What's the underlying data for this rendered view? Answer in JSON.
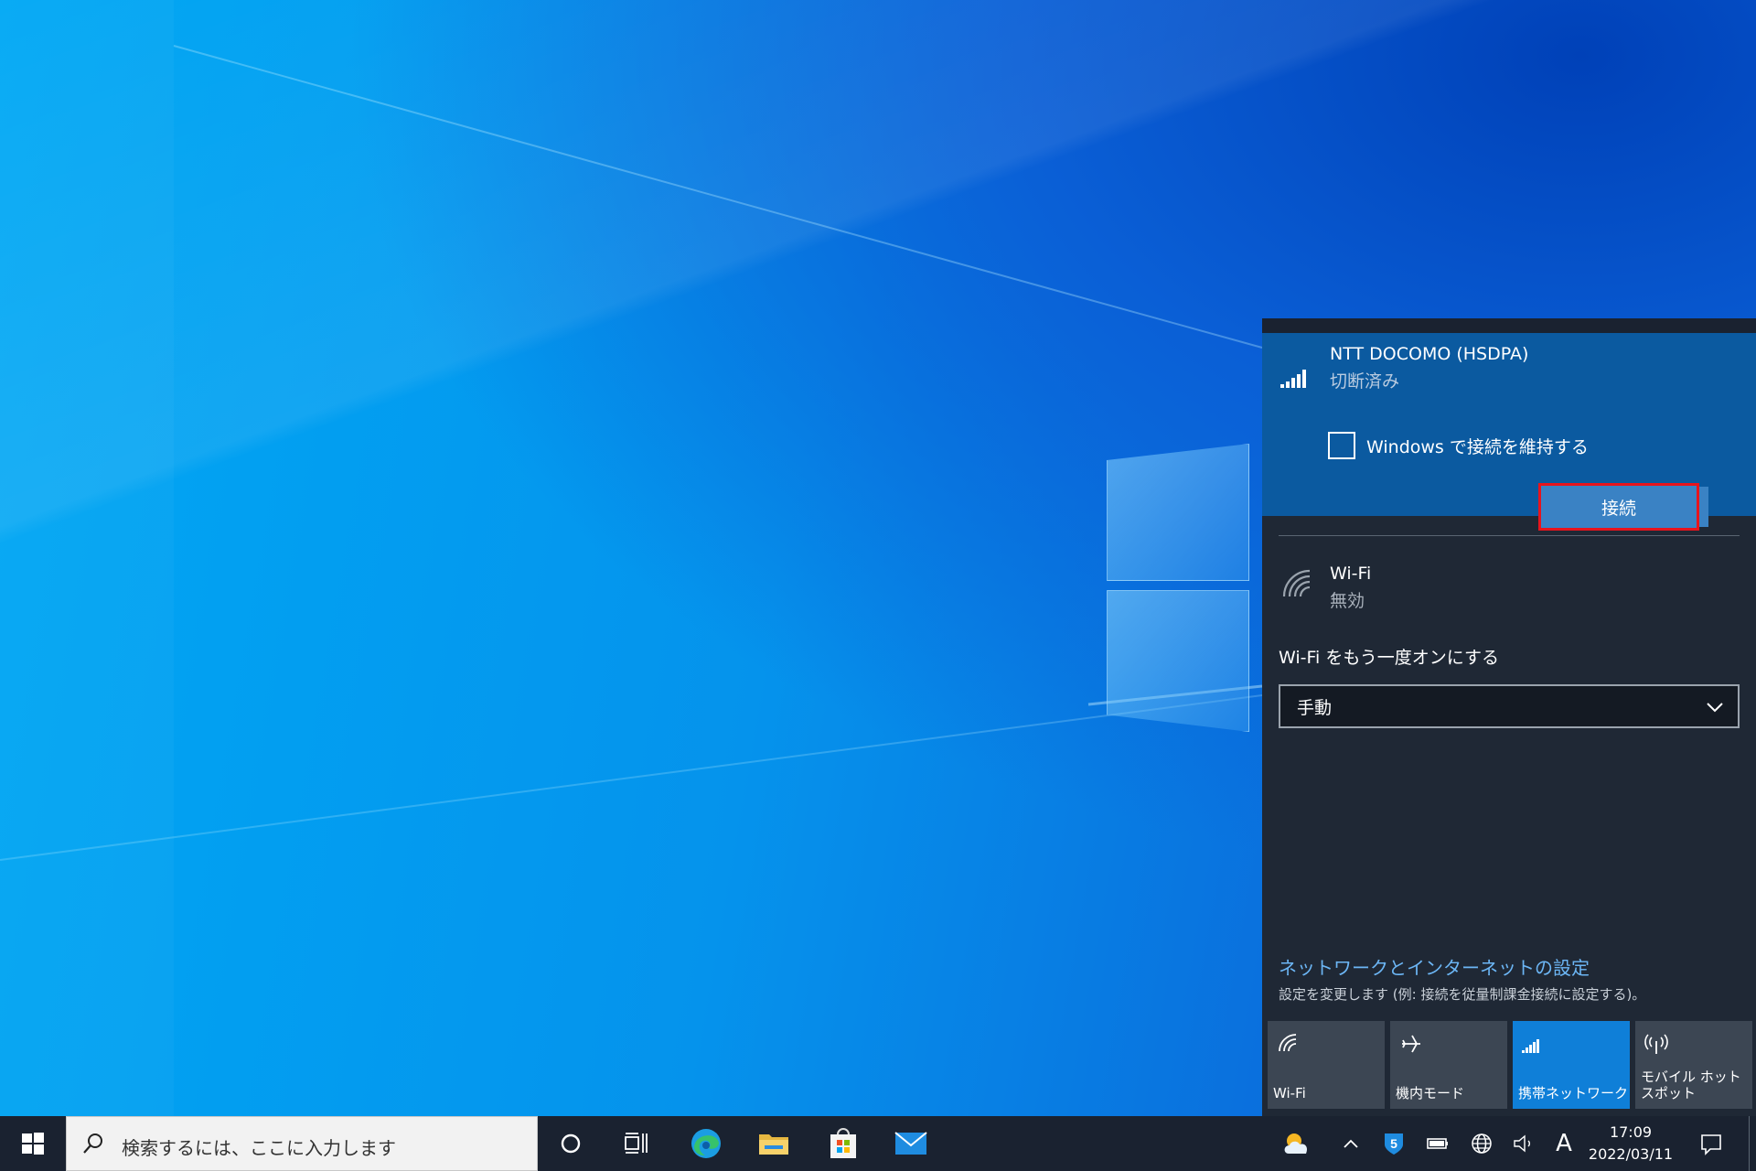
{
  "flyout": {
    "cellular": {
      "name": "NTT DOCOMO (HSDPA)",
      "status": "切断済み",
      "keep_connected_label": "Windows で接続を維持する",
      "keep_connected_checked": false,
      "connect_button": "接続"
    },
    "wifi": {
      "name": "Wi-Fi",
      "status": "無効",
      "turn_on_label": "Wi-Fi をもう一度オンにする",
      "turn_on_value": "手動"
    },
    "settings": {
      "link": "ネットワークとインターネットの設定",
      "description": "設定を変更します (例: 接続を従量制課金接続に設定する)。"
    },
    "tiles": [
      {
        "label": "Wi-Fi",
        "icon": "wifi-icon",
        "active": false
      },
      {
        "label": "機内モード",
        "icon": "airplane-icon",
        "active": false
      },
      {
        "label": "携帯ネットワーク",
        "icon": "cellular-icon",
        "active": true
      },
      {
        "label": "モバイル ホットスポット",
        "icon": "hotspot-icon",
        "active": false
      }
    ]
  },
  "taskbar": {
    "search_placeholder": "検索するには、ここに入力します",
    "ime_indicator": "A",
    "time": "17:09",
    "date": "2022/03/11"
  },
  "colors": {
    "accent": "#0f7fd8",
    "flyout_bg": "#1f2835",
    "cell_section_bg": "#0b5aa0",
    "highlight_border": "#e8141c",
    "link": "#6cb6f5"
  }
}
